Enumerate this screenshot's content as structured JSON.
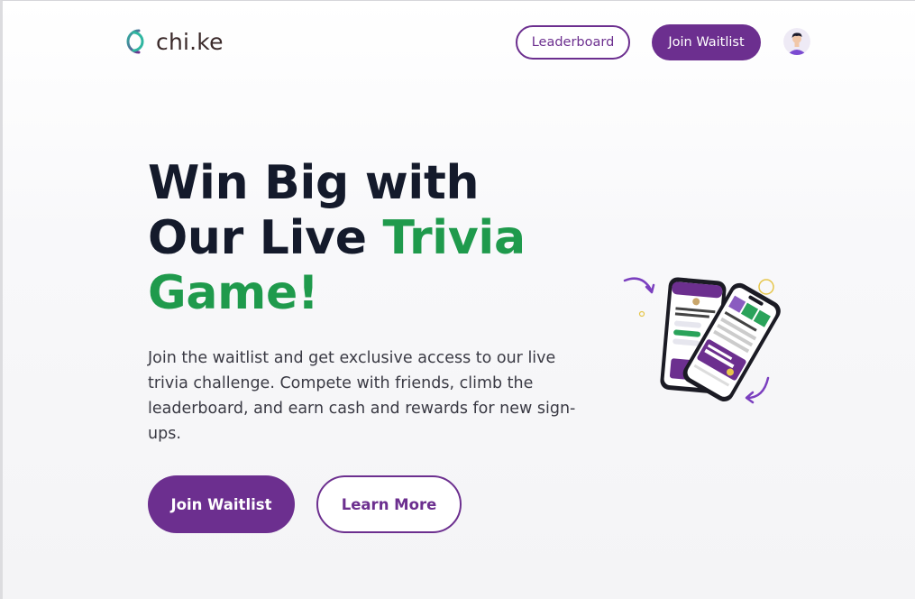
{
  "header": {
    "logo_text": "chi.ke",
    "leaderboard_label": "Leaderboard",
    "join_label": "Join Waitlist",
    "avatar_icon": "user-avatar-icon"
  },
  "hero": {
    "headline_part1": "Win Big with Our Live ",
    "headline_highlight": "Trivia Game!",
    "description": "Join the waitlist and get exclusive access to our live trivia challenge. Compete with friends, climb the leaderboard, and earn cash and rewards for new sign-ups.",
    "primary_cta": "Join Waitlist",
    "secondary_cta": "Learn More",
    "illustration": "phones-illustration"
  },
  "colors": {
    "brand_purple": "#6c2f8f",
    "accent_green": "#1f9a4c",
    "heading_dark": "#141a2b"
  }
}
